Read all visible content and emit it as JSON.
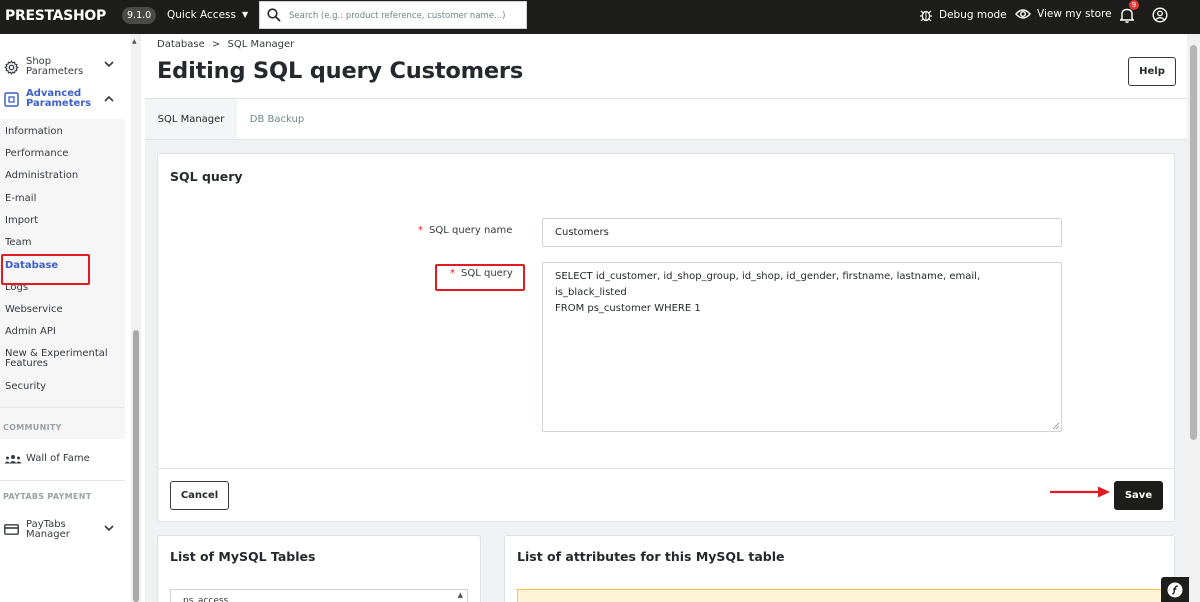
{
  "topbar": {
    "logo": "PRESTASHOP",
    "version": "9.1.0",
    "quick_access": "Quick Access",
    "search_placeholder": "Search (e.g.: product reference, customer name...)",
    "debug_mode": "Debug mode",
    "view_my_store": "View my store",
    "notification_count": "9"
  },
  "sidebar": {
    "shop_parameters": "Shop Parameters",
    "advanced_parameters": "Advanced Parameters",
    "sub_items": [
      "Information",
      "Performance",
      "Administration",
      "E-mail",
      "Import",
      "Team",
      "Database",
      "Logs",
      "Webservice",
      "Admin API",
      "New & Experimental Features",
      "Security"
    ],
    "active_sub_item": "Database",
    "community_heading": "COMMUNITY",
    "wall_of_fame": "Wall of Fame",
    "paytabs_heading": "PAYTABS PAYMENT",
    "paytabs_manager": "PayTabs Manager"
  },
  "header": {
    "breadcrumb_parent": "Database",
    "breadcrumb_separator": ">",
    "breadcrumb_current": "SQL Manager",
    "title": "Editing SQL query Customers",
    "help_label": "Help"
  },
  "tabs": [
    {
      "label": "SQL Manager",
      "active": true
    },
    {
      "label": "DB Backup",
      "active": false
    }
  ],
  "sql_card": {
    "title": "SQL query",
    "name_label": "SQL query name",
    "name_value": "Customers",
    "query_label": "SQL query",
    "query_line1": "SELECT id_customer, id_shop_group, id_shop, id_gender, firstname, lastname, email, is_black_listed",
    "query_line2": "FROM ps_customer WHERE 1",
    "required_marker": "*",
    "cancel_label": "Cancel",
    "save_label": "Save"
  },
  "tables_card": {
    "title": "List of MySQL Tables",
    "first_option": "ps_access"
  },
  "attributes_card": {
    "title": "List of attributes for this MySQL table"
  },
  "colors": {
    "topbar_bg": "#1d1d1b",
    "active_nav": "#3b5fcc",
    "highlight_red": "#e01b24",
    "save_bg": "#1d1d1b"
  }
}
